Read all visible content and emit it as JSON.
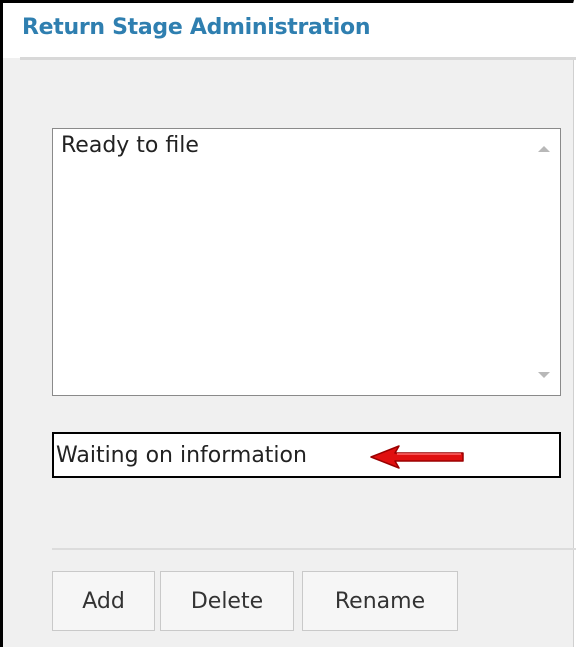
{
  "dialog": {
    "title": "Return Stage Administration"
  },
  "stage_list": {
    "items": [
      "Ready to file"
    ]
  },
  "stage_name_input": {
    "value": "Waiting on information"
  },
  "annotation": {
    "arrow_color": "#e01010"
  },
  "buttons": {
    "add_label": "Add",
    "delete_label": "Delete",
    "rename_label": "Rename"
  },
  "colors": {
    "title": "#2f7fb0",
    "background": "#f0f0f0"
  }
}
